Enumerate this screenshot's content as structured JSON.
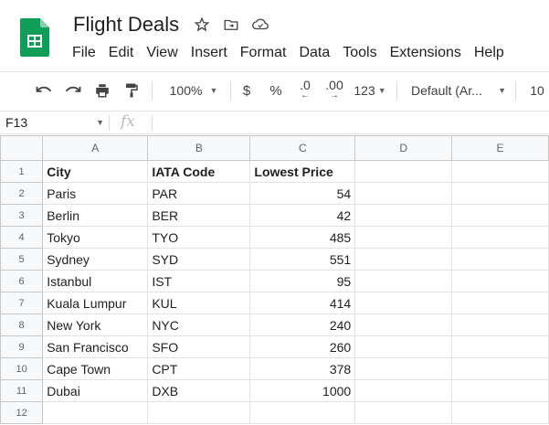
{
  "doc": {
    "title": "Flight Deals",
    "title_icons": [
      "star-icon",
      "move-to-folder-icon",
      "cloud-saved-icon"
    ]
  },
  "menu": [
    "File",
    "Edit",
    "View",
    "Insert",
    "Format",
    "Data",
    "Tools",
    "Extensions",
    "Help"
  ],
  "toolbar": {
    "zoom": "100%",
    "currency": "$",
    "percent": "%",
    "decrease_decimal": ".0",
    "increase_decimal": ".00",
    "more_formats": "123",
    "font": "Default (Ar...",
    "font_size": "10"
  },
  "formula_bar": {
    "cell_ref": "F13",
    "fx": "fx",
    "value": ""
  },
  "sheet": {
    "columns": [
      "A",
      "B",
      "C",
      "D",
      "E"
    ],
    "rows": [
      [
        "City",
        "IATA Code",
        "Lowest Price",
        "",
        ""
      ],
      [
        "Paris",
        "PAR",
        "54",
        "",
        ""
      ],
      [
        "Berlin",
        "BER",
        "42",
        "",
        ""
      ],
      [
        "Tokyo",
        "TYO",
        "485",
        "",
        ""
      ],
      [
        "Sydney",
        "SYD",
        "551",
        "",
        ""
      ],
      [
        "Istanbul",
        "IST",
        "95",
        "",
        ""
      ],
      [
        "Kuala Lumpur",
        "KUL",
        "414",
        "",
        ""
      ],
      [
        "New York",
        "NYC",
        "240",
        "",
        ""
      ],
      [
        "San Francisco",
        "SFO",
        "260",
        "",
        ""
      ],
      [
        "Cape Town",
        "CPT",
        "378",
        "",
        ""
      ],
      [
        "Dubai",
        "DXB",
        "1000",
        "",
        ""
      ],
      [
        "",
        "",
        "",
        "",
        ""
      ]
    ]
  }
}
